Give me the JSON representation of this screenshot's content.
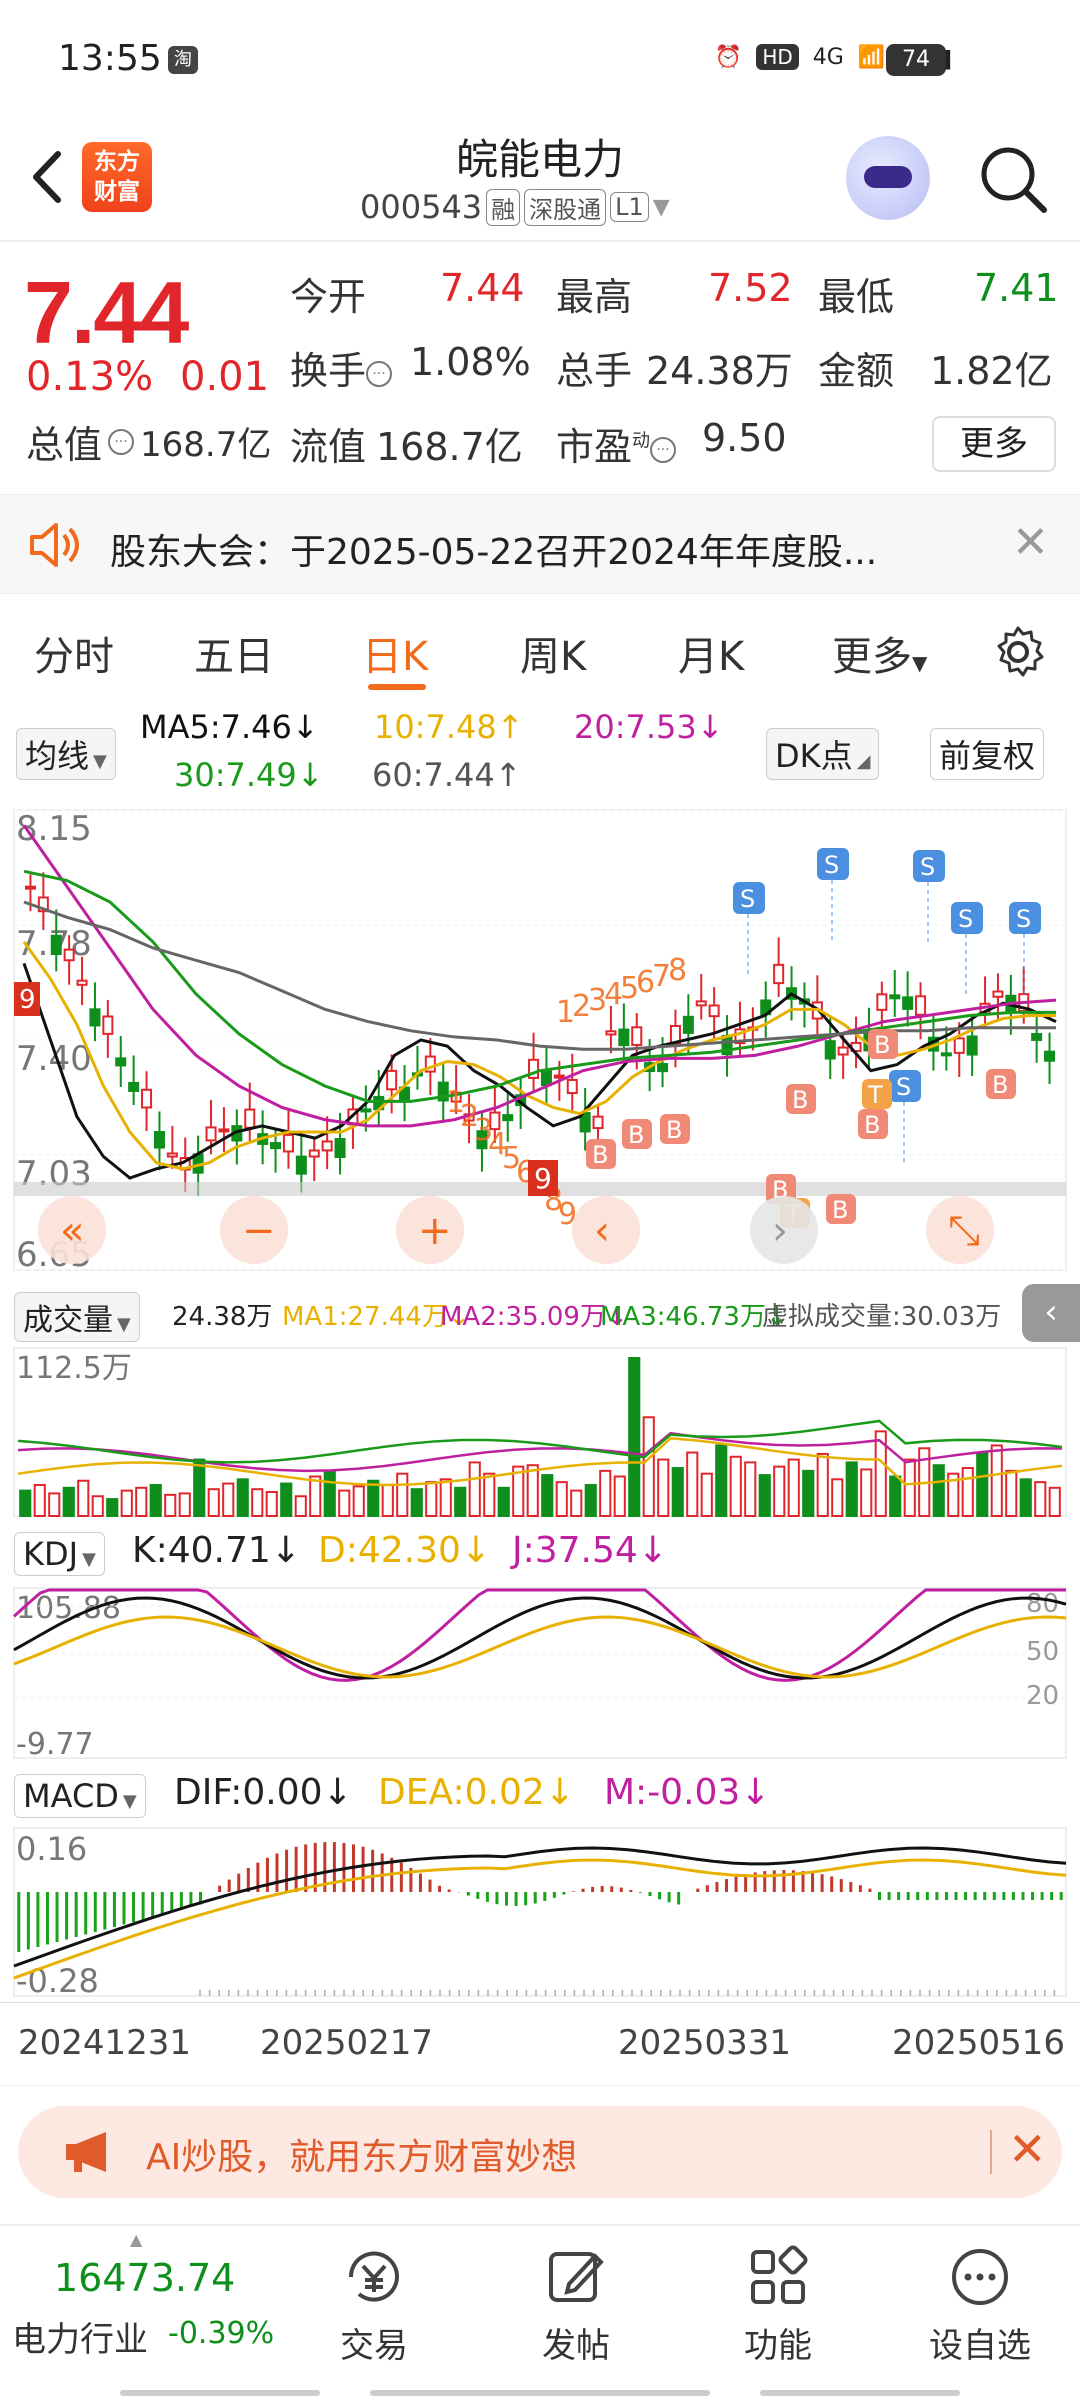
{
  "status": {
    "time": "13:55",
    "app_badge": "淘",
    "hd": "HD",
    "net": "4G",
    "battery": "74"
  },
  "header": {
    "title": "皖能电力",
    "code": "000543",
    "tags": [
      "融",
      "深股通",
      "L1"
    ],
    "logo_line1": "东方",
    "logo_line2": "财富"
  },
  "quote": {
    "price": "7.44",
    "pct": "0.13%",
    "change": "0.01",
    "open_label": "今开",
    "open": "7.44",
    "high_label": "最高",
    "high": "7.52",
    "low_label": "最低",
    "low": "7.41",
    "turnover_label": "换手",
    "turnover": "1.08%",
    "volume_label": "总手",
    "volume": "24.38万",
    "amount_label": "金额",
    "amount": "1.82亿",
    "mcap_label": "总值",
    "mcap": "168.7亿",
    "float_label": "流值",
    "float": "168.7亿",
    "pe_label": "市盈",
    "pe_sup": "动",
    "pe": "9.50",
    "more": "更多"
  },
  "notice": {
    "text": "股东大会：于2025-05-22召开2024年年度股..."
  },
  "tabs": [
    {
      "label": "分时"
    },
    {
      "label": "五日"
    },
    {
      "label": "日K"
    },
    {
      "label": "周K"
    },
    {
      "label": "月K"
    },
    {
      "label": "更多"
    }
  ],
  "ma": {
    "selector": "均线",
    "ma5": "MA5:7.46↓",
    "ma10": "10:7.48↑",
    "ma20": "20:7.53↓",
    "ma30": "30:7.49↓",
    "ma60": "60:7.44↑",
    "dk": "DK点",
    "fq": "前复权"
  },
  "colors": {
    "red": "#e0262b",
    "green": "#0e8f1c",
    "orange": "#f26a1b",
    "ma5": "#111111",
    "ma10": "#e8b100",
    "ma20": "#c020a0",
    "ma30": "#1a9a1a",
    "ma60": "#666666"
  },
  "chart_data": [
    {
      "type": "candlestick",
      "title": "日K",
      "ylim": [
        6.65,
        8.15
      ],
      "y_ticks": [
        "8.15",
        "7.78",
        "7.40",
        "7.03",
        "6.65"
      ],
      "x_ticks": [
        "20241231",
        "20250217",
        "20250331",
        "20250516"
      ],
      "markers_b": [
        "B",
        "B",
        "B",
        "B",
        "B",
        "B",
        "B",
        "B",
        "B"
      ],
      "markers_s": [
        "S",
        "S",
        "S",
        "S",
        "S",
        "S"
      ],
      "markers_t": [
        "T",
        "T"
      ],
      "count_labels_up": [
        "1",
        "2",
        "3",
        "4",
        "5",
        "6",
        "7",
        "8"
      ],
      "count_labels_down": [
        "1",
        "2",
        "3",
        "4",
        "5",
        "6",
        "7",
        "8",
        "9"
      ],
      "side_marker": "9",
      "series": [
        {
          "name": "MA5",
          "values": [
            7.65,
            7.4,
            7.15,
            7.02,
            6.95,
            6.98,
            7.0,
            7.05,
            7.1,
            7.12,
            7.1,
            7.08,
            7.12,
            7.2,
            7.35,
            7.4,
            7.38,
            7.3,
            7.25,
            7.18,
            7.12,
            7.15,
            7.25,
            7.35,
            7.38,
            7.4,
            7.42,
            7.45,
            7.48,
            7.55,
            7.5,
            7.4,
            7.3,
            7.32,
            7.38,
            7.42,
            7.48,
            7.52,
            7.5,
            7.46
          ]
        },
        {
          "name": "MA10",
          "values": [
            7.72,
            7.6,
            7.45,
            7.25,
            7.1,
            7.0,
            6.98,
            7.0,
            7.05,
            7.08,
            7.1,
            7.1,
            7.1,
            7.14,
            7.22,
            7.3,
            7.33,
            7.32,
            7.28,
            7.22,
            7.18,
            7.16,
            7.2,
            7.28,
            7.33,
            7.37,
            7.4,
            7.42,
            7.45,
            7.5,
            7.5,
            7.45,
            7.38,
            7.35,
            7.37,
            7.4,
            7.44,
            7.47,
            7.48,
            7.48
          ]
        }
      ]
    },
    {
      "type": "bar",
      "title": "成交量",
      "value": "24.38万",
      "ma1": "MA1:27.44万↓",
      "ma2": "MA2:35.09万↓",
      "ma3": "MA3:46.73万↓",
      "virtual": "虚拟成交量:30.03万",
      "y_top": "112.5万",
      "values": [
        18,
        22,
        16,
        20,
        25,
        14,
        12,
        18,
        20,
        22,
        15,
        16,
        40,
        19,
        23,
        26,
        19,
        17,
        23,
        14,
        28,
        32,
        18,
        21,
        25,
        22,
        30,
        19,
        24,
        26,
        20,
        38,
        30,
        20,
        35,
        36,
        29,
        24,
        18,
        22,
        32,
        28,
        112,
        70,
        40,
        34,
        45,
        30,
        50,
        42,
        38,
        29,
        35,
        40,
        32,
        44,
        26,
        38,
        33,
        60,
        28,
        40,
        48,
        36,
        30,
        34,
        45,
        50,
        32,
        26,
        24,
        20
      ]
    },
    {
      "type": "line",
      "title": "KDJ",
      "k": "K:40.71↓",
      "d": "D:42.30↓",
      "j": "J:37.54↓",
      "y_top": "105.88",
      "y_bottom": "-9.77",
      "levels": [
        "80",
        "50",
        "20"
      ]
    },
    {
      "type": "bar",
      "title": "MACD",
      "dif": "DIF:0.00↓",
      "dea": "DEA:0.02↓",
      "m": "M:-0.03↓",
      "y_top": "0.16",
      "y_bottom": "-0.28"
    }
  ],
  "ai_banner": {
    "text": "AI炒股，就用东方财富妙想"
  },
  "bottom": {
    "index_value": "16473.74",
    "index_name": "电力行业",
    "index_pct": "-0.39%",
    "nav": [
      {
        "label": "交易"
      },
      {
        "label": "发帖"
      },
      {
        "label": "功能"
      },
      {
        "label": "设自选"
      }
    ]
  }
}
